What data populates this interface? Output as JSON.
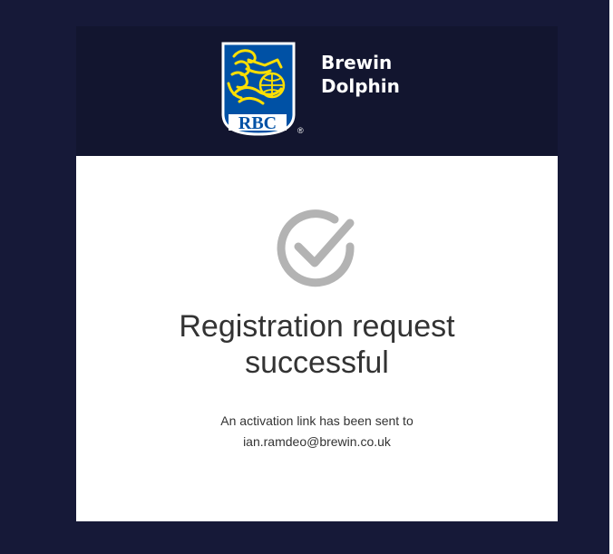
{
  "brand": {
    "logo_text": "RBC",
    "name_line1": "Brewin",
    "name_line2": "Dolphin",
    "registered_mark": "®"
  },
  "colors": {
    "page_background": "#161938",
    "header_background": "#12152f",
    "shield_blue": "#0051a5",
    "shield_gold": "#fedf01",
    "check_gray": "#b3b3b3",
    "text": "#333333"
  },
  "success": {
    "icon": "check-circle-icon",
    "title_line1": "Registration request",
    "title_line2": "successful",
    "message_line1": "An activation link has been sent to",
    "email": "ian.ramdeo@brewin.co.uk"
  }
}
